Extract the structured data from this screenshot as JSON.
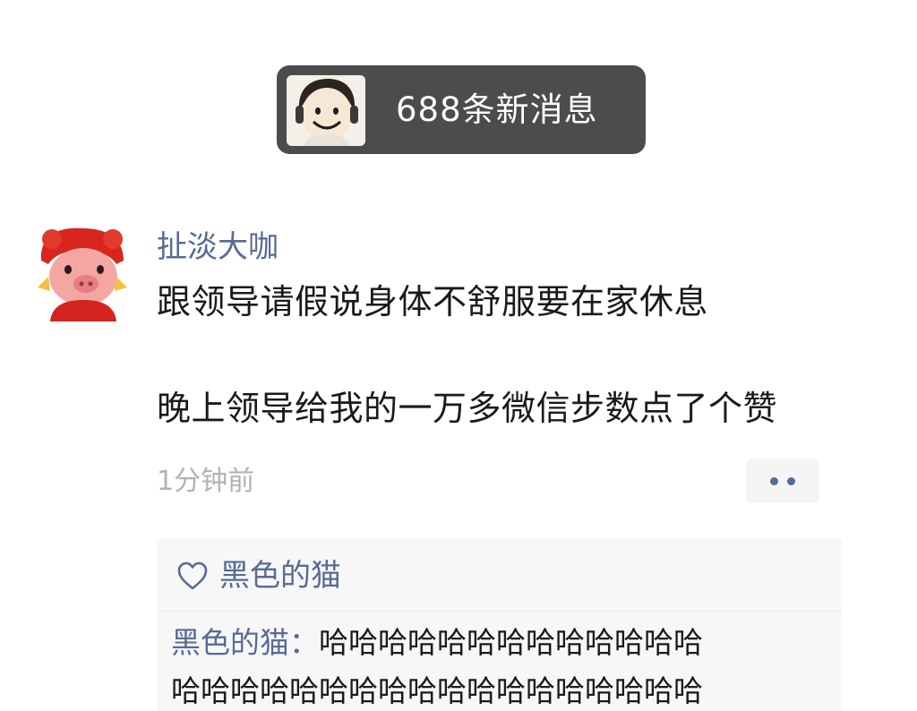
{
  "notification": {
    "text": "688条新消息",
    "avatar_icon": "cartoon-face-avatar-icon"
  },
  "post": {
    "author": "扯淡大咖",
    "avatar_icon": "cartoon-pig-avatar-icon",
    "line1": "跟领导请假说身体不舒服要在家休息",
    "line2": "晚上领导给我的一万多微信步数点了个赞",
    "time": "1分钟前",
    "more_icon": "more-dots-icon"
  },
  "likes": {
    "icon": "heart-icon",
    "names": "黑色的猫"
  },
  "comment": {
    "author": "黑色的猫：",
    "line1_text": "哈哈哈哈哈哈哈哈哈哈哈哈哈",
    "line2_text": "哈哈哈哈哈哈哈哈哈哈哈哈哈哈哈哈哈哈"
  },
  "colors": {
    "link_blue": "#576b95",
    "pill_bg": "#4c4c4c",
    "comment_bg": "#f7f7f7",
    "time_gray": "#b2b2b2"
  }
}
